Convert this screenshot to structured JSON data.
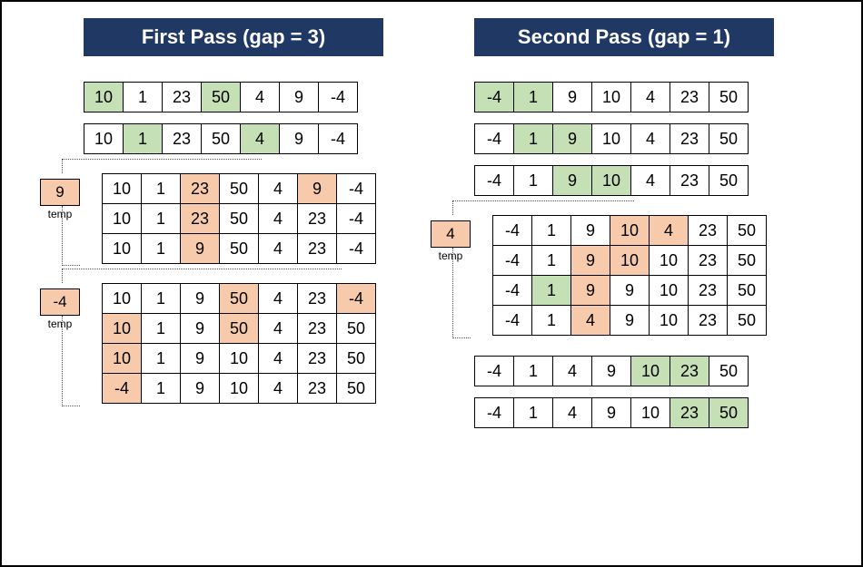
{
  "left": {
    "title": "First Pass (gap = 3)",
    "row1": {
      "values": [
        "10",
        "1",
        "23",
        "50",
        "4",
        "9",
        "-4"
      ],
      "highlights": {
        "0": "green",
        "3": "green"
      }
    },
    "row2": {
      "values": [
        "10",
        "1",
        "23",
        "50",
        "4",
        "9",
        "-4"
      ],
      "highlights": {
        "1": "green",
        "4": "green"
      }
    },
    "group1": {
      "temp": "9",
      "temp_label": "temp",
      "rows": [
        {
          "values": [
            "10",
            "1",
            "23",
            "50",
            "4",
            "9",
            "-4"
          ],
          "highlights": {
            "2": "orange",
            "5": "orange"
          }
        },
        {
          "values": [
            "10",
            "1",
            "23",
            "50",
            "4",
            "23",
            "-4"
          ],
          "highlights": {
            "2": "orange"
          }
        },
        {
          "values": [
            "10",
            "1",
            "9",
            "50",
            "4",
            "23",
            "-4"
          ],
          "highlights": {
            "2": "orange"
          }
        }
      ]
    },
    "group2": {
      "temp": "-4",
      "temp_label": "temp",
      "rows": [
        {
          "values": [
            "10",
            "1",
            "9",
            "50",
            "4",
            "23",
            "-4"
          ],
          "highlights": {
            "3": "orange",
            "6": "orange"
          }
        },
        {
          "values": [
            "10",
            "1",
            "9",
            "50",
            "4",
            "23",
            "50"
          ],
          "highlights": {
            "0": "orange",
            "3": "orange"
          }
        },
        {
          "values": [
            "10",
            "1",
            "9",
            "10",
            "4",
            "23",
            "50"
          ],
          "highlights": {
            "0": "orange"
          }
        },
        {
          "values": [
            "-4",
            "1",
            "9",
            "10",
            "4",
            "23",
            "50"
          ],
          "highlights": {
            "0": "orange"
          }
        }
      ]
    }
  },
  "right": {
    "title": "Second Pass (gap = 1)",
    "row1": {
      "values": [
        "-4",
        "1",
        "9",
        "10",
        "4",
        "23",
        "50"
      ],
      "highlights": {
        "0": "green",
        "1": "green"
      }
    },
    "row2": {
      "values": [
        "-4",
        "1",
        "9",
        "10",
        "4",
        "23",
        "50"
      ],
      "highlights": {
        "1": "green",
        "2": "green"
      }
    },
    "row3": {
      "values": [
        "-4",
        "1",
        "9",
        "10",
        "4",
        "23",
        "50"
      ],
      "highlights": {
        "2": "green",
        "3": "green"
      }
    },
    "group1": {
      "temp": "4",
      "temp_label": "temp",
      "rows": [
        {
          "values": [
            "-4",
            "1",
            "9",
            "10",
            "4",
            "23",
            "50"
          ],
          "highlights": {
            "3": "orange",
            "4": "orange"
          }
        },
        {
          "values": [
            "-4",
            "1",
            "9",
            "10",
            "10",
            "23",
            "50"
          ],
          "highlights": {
            "2": "orange",
            "3": "orange"
          }
        },
        {
          "values": [
            "-4",
            "1",
            "9",
            "9",
            "10",
            "23",
            "50"
          ],
          "highlights": {
            "1": "green",
            "2": "orange"
          }
        },
        {
          "values": [
            "-4",
            "1",
            "4",
            "9",
            "10",
            "23",
            "50"
          ],
          "highlights": {
            "2": "orange"
          }
        }
      ]
    },
    "row4": {
      "values": [
        "-4",
        "1",
        "4",
        "9",
        "10",
        "23",
        "50"
      ],
      "highlights": {
        "4": "green",
        "5": "green"
      }
    },
    "row5": {
      "values": [
        "-4",
        "1",
        "4",
        "9",
        "10",
        "23",
        "50"
      ],
      "highlights": {
        "5": "green",
        "6": "green"
      }
    }
  }
}
